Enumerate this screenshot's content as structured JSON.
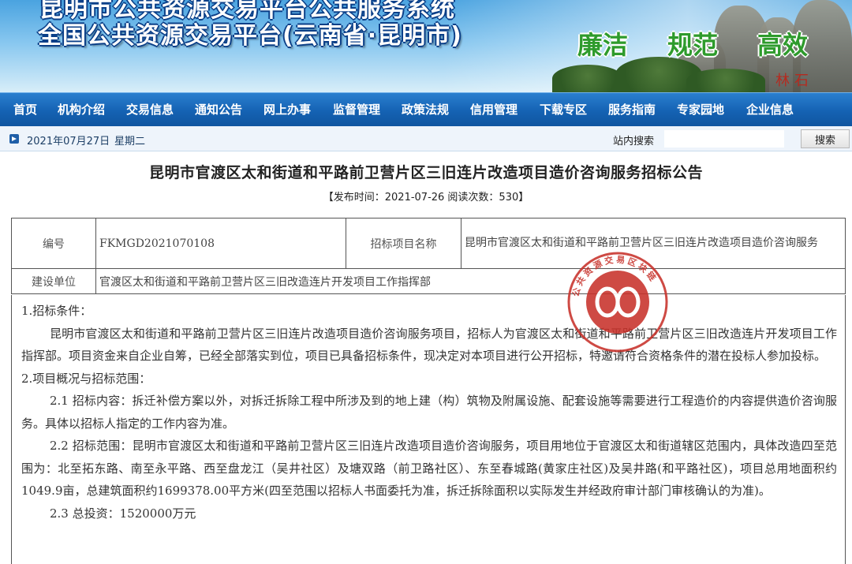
{
  "banner": {
    "line1": "昆明市公共资源交易平台公共服务系统",
    "line2": "全国公共资源交易平台(云南省·昆明市)",
    "slogans": [
      "廉洁",
      "规范",
      "高效"
    ],
    "stone_carving": "林石"
  },
  "nav": {
    "items": [
      "首页",
      "机构介绍",
      "交易信息",
      "通知公告",
      "网上办事",
      "监督管理",
      "政策法规",
      "信用管理",
      "下载专区",
      "服务指南",
      "专家园地",
      "企业信息"
    ]
  },
  "datebar": {
    "date": "2021年07月27日",
    "weekday": "星期二",
    "search_label": "站内搜索",
    "search_value": "",
    "search_button": "搜索"
  },
  "article": {
    "title": "昆明市官渡区太和街道和平路前卫营片区三旧连片改造项目造价咨询服务招标公告",
    "meta": "【发布时间：2021-07-26  阅读次数：530】"
  },
  "info_table": {
    "label_number": "编号",
    "number": "FKMGD2021070108",
    "label_project_name": "招标项目名称",
    "project_name": "昆明市官渡区太和街道和平路前卫营片区三旧连片改造项目造价咨询服务",
    "label_unit": "建设单位",
    "unit": "官渡区太和街道和平路前卫营片区三旧改造连片开发项目工作指挥部"
  },
  "content": {
    "s1_heading": "1.招标条件：",
    "s1_body": "昆明市官渡区太和街道和平路前卫营片区三旧连片改造项目造价咨询服务项目，招标人为官渡区太和街道和平路前卫营片区三旧改造连片开发项目工作指挥部。项目资金来自企业自筹，已经全部落实到位，项目已具备招标条件，现决定对本项目进行公开招标，特邀请符合资格条件的潜在投标人参加投标。",
    "s2_heading": "2.项目概况与招标范围：",
    "s2_1": "2.1 招标内容：拆迁补偿方案以外，对拆迁拆除工程中所涉及到的地上建（构）筑物及附属设施、配套设施等需要进行工程造价的内容提供造价咨询服务。具体以招标人指定的工作内容为准。",
    "s2_2": "2.2 招标范围：昆明市官渡区太和街道和平路前卫营片区三旧连片改造项目造价咨询服务，项目用地位于官渡区太和街道辖区范围内，具体改造四至范围为：北至拓东路、南至永平路、西至盘龙江（吴井社区）及塘双路（前卫路社区）、东至春城路(黄家庄社区)及吴井路(和平路社区)，项目总用地面积约1049.9亩，总建筑面积约1699378.00平方米(四至范围以招标人书面委托为准，拆迁拆除面积以实际发生并经政府审计部门审核确认的为准)。",
    "s2_3": "2.3 总投资：1520000万元"
  },
  "seal": {
    "text": "公共资源交易区块链"
  },
  "colors": {
    "nav_blue": "#1562b3",
    "seal_red": "#c8322b",
    "slogan_green": "#2e9b2c"
  }
}
